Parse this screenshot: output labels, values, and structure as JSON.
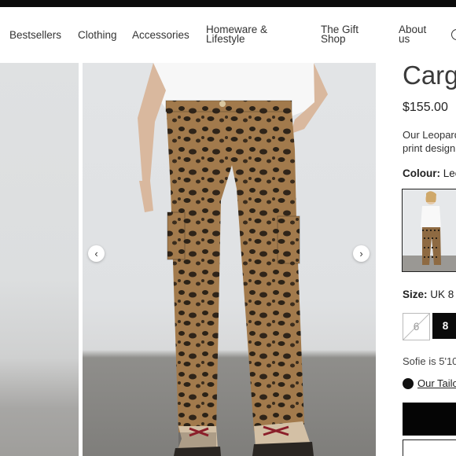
{
  "nav": {
    "items": [
      {
        "label": "Bestsellers"
      },
      {
        "label": "Clothing"
      },
      {
        "label": "Accessories"
      },
      {
        "label_line1": "Homeware &",
        "label_line2": "Lifestyle"
      },
      {
        "label_line1": "The Gift",
        "label_line2": "Shop"
      },
      {
        "label_line1": "About",
        "label_line2": "us"
      }
    ]
  },
  "gallery": {
    "prev_icon": "chevron-left-icon",
    "next_icon": "chevron-right-icon",
    "prev_glyph": "‹",
    "next_glyph": "›"
  },
  "product": {
    "title": "Carg",
    "price": "$155.00",
    "description_line1": "Our Leopard",
    "description_line2": "print design",
    "colour_label": "Colour:",
    "colour_value": "Leo",
    "size_label": "Size:",
    "size_value": "UK 8",
    "sizes": [
      {
        "label": "6",
        "available": false
      },
      {
        "label": "8",
        "available": true,
        "selected": true
      }
    ],
    "fit_note": "Sofie is 5'10",
    "tailor_link": "Our Tailo"
  },
  "colors": {
    "leopard_base": "#a27a4c",
    "leopard_spot": "#2b2217",
    "primary_button": "#050505"
  }
}
